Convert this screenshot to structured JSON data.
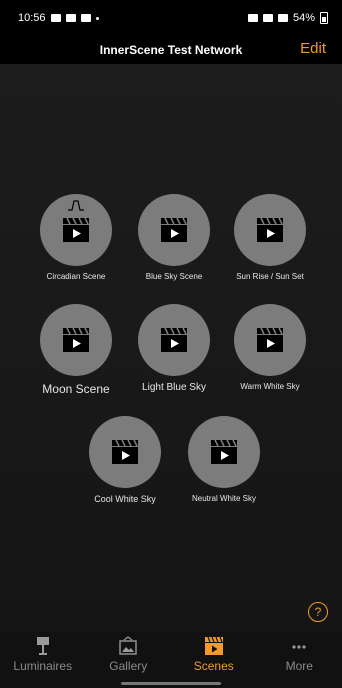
{
  "status_bar": {
    "time": "10:56",
    "battery": "54%"
  },
  "nav": {
    "title": "InnerScene Test Network",
    "edit_label": "Edit"
  },
  "scenes": [
    {
      "label": "Circadian Scene",
      "icon": "circadian-wave-icon"
    },
    {
      "label": "Blue Sky Scene"
    },
    {
      "label": "Sun Rise / Sun Set"
    },
    {
      "label": "Moon Scene"
    },
    {
      "label": "Light Blue Sky"
    },
    {
      "label": "Warm White Sky"
    },
    {
      "label": "Cool White Sky"
    },
    {
      "label": "Neutral White Sky"
    }
  ],
  "help": {
    "symbol": "?"
  },
  "tabs": [
    {
      "label": "Luminaires",
      "icon": "lamp-icon",
      "active": false
    },
    {
      "label": "Gallery",
      "icon": "gallery-icon",
      "active": false
    },
    {
      "label": "Scenes",
      "icon": "clapperboard-icon",
      "active": true
    },
    {
      "label": "More",
      "icon": "more-dots-icon",
      "active": false
    }
  ],
  "colors": {
    "accent": "#f39a2b",
    "scene_circle": "#7c7c7c",
    "background": "#1a1a1a"
  }
}
